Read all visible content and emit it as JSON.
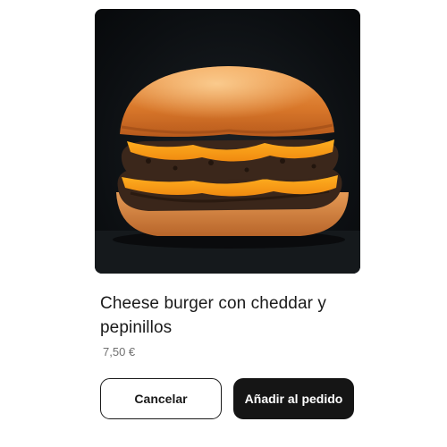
{
  "product": {
    "image_alt": "cheeseburger-photo",
    "title": "Cheese burger con cheddar y pepinillos",
    "price": "7,50 €"
  },
  "actions": {
    "cancel_label": "Cancelar",
    "add_label": "Añadir al pedido"
  },
  "colors": {
    "primary_button": "#151515",
    "background": "#ffffff",
    "price_text": "#707070"
  }
}
